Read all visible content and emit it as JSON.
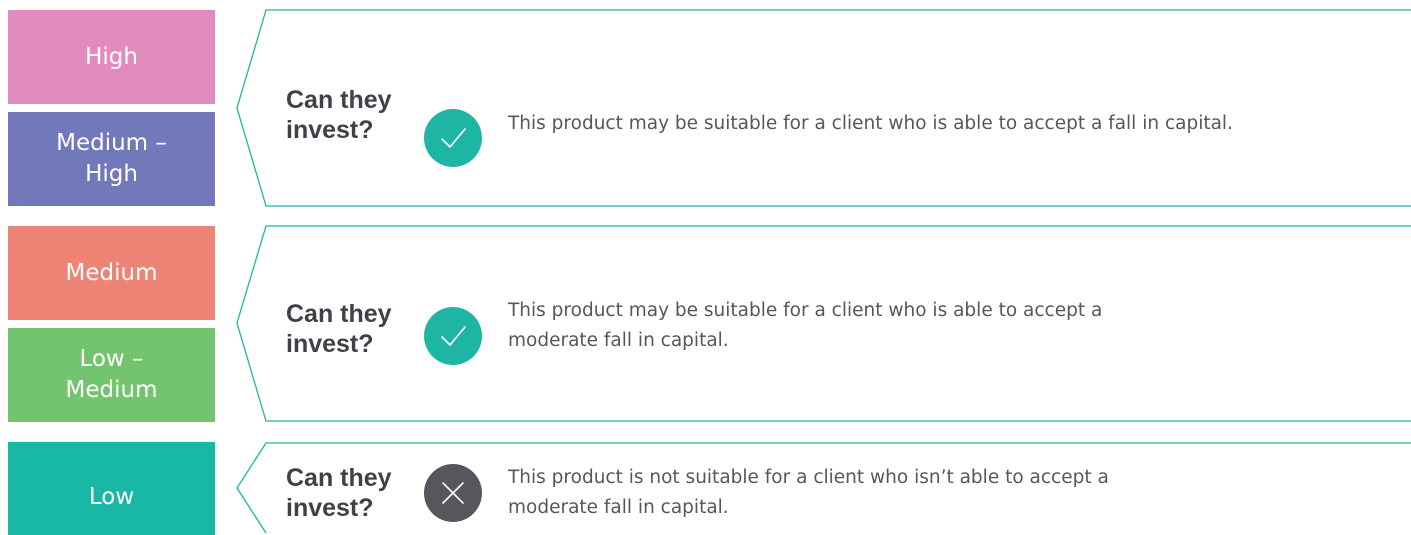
{
  "colors": {
    "high": "#e28bbf",
    "medium_high": "#7378bb",
    "medium": "#ee8475",
    "low_medium": "#73c46e",
    "low": "#19b7a6",
    "callout_border": "#1fb5a5",
    "check_fill": "#1fb5a5",
    "cross_fill": "#55575c"
  },
  "risk_levels": {
    "high": "High",
    "medium_high_line1": "Medium –",
    "medium_high_line2": "High",
    "medium": "Medium",
    "low_medium_line1": "Low –",
    "low_medium_line2": "Medium",
    "low": "Low"
  },
  "rows": [
    {
      "question_line1": "Can they",
      "question_line2": "invest?",
      "icon": "check-icon",
      "description": "This product may be suitable for a client who is able to accept a fall in capital."
    },
    {
      "question_line1": "Can they",
      "question_line2": "invest?",
      "icon": "check-icon",
      "description": "This product may be suitable for a client who is able to accept a moderate fall in capital."
    },
    {
      "question_line1": "Can they",
      "question_line2": "invest?",
      "icon": "cross-icon",
      "description": "This product is not suitable for a client who isn’t able to accept a moderate fall in capital."
    }
  ]
}
